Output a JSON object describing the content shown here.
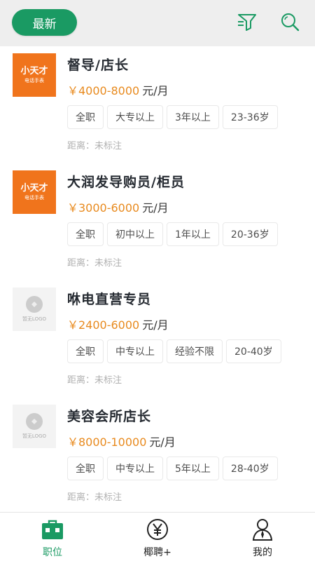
{
  "header": {
    "latest_label": "最新",
    "filter_icon": "filter-icon",
    "search_icon": "search-icon",
    "accent_color": "#1a9a63"
  },
  "jobs": [
    {
      "logo": {
        "type": "brand",
        "name": "小天才",
        "sub": "电话手表"
      },
      "title": "督导/店长",
      "salary": "￥4000-8000",
      "salary_unit": "元/月",
      "tags": [
        "全职",
        "大专以上",
        "3年以上",
        "23-36岁"
      ],
      "distance": "距离：未标注"
    },
    {
      "logo": {
        "type": "brand",
        "name": "小天才",
        "sub": "电话手表"
      },
      "title": "大润发导购员/柜员",
      "salary": "￥3000-6000",
      "salary_unit": "元/月",
      "tags": [
        "全职",
        "初中以上",
        "1年以上",
        "20-36岁"
      ],
      "distance": "距离：未标注"
    },
    {
      "logo": {
        "type": "placeholder",
        "text": "暂无LOGO"
      },
      "title": "咻电直营专员",
      "salary": "￥2400-6000",
      "salary_unit": "元/月",
      "tags": [
        "全职",
        "中专以上",
        "经验不限",
        "20-40岁"
      ],
      "distance": "距离：未标注"
    },
    {
      "logo": {
        "type": "placeholder",
        "text": "暂无LOGO"
      },
      "title": "美容会所店长",
      "salary": "￥8000-10000",
      "salary_unit": "元/月",
      "tags": [
        "全职",
        "中专以上",
        "5年以上",
        "28-40岁"
      ],
      "distance": "距离：未标注"
    }
  ],
  "nav": {
    "items": [
      {
        "label": "职位",
        "icon": "briefcase-icon",
        "active": true
      },
      {
        "label": "椰聘+",
        "icon": "yen-icon",
        "active": false
      },
      {
        "label": "我的",
        "icon": "user-icon",
        "active": false
      }
    ]
  },
  "colors": {
    "salary": "#e88a1e",
    "brand_logo": "#f0741c",
    "active_nav": "#1a9a63"
  }
}
